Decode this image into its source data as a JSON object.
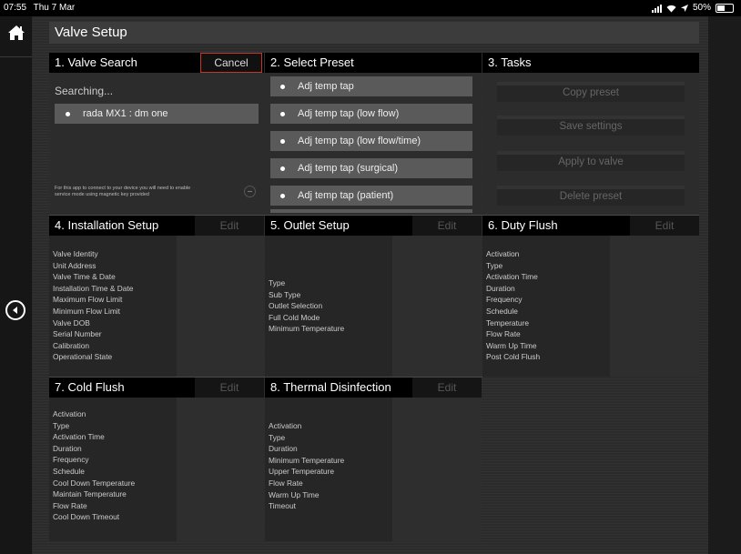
{
  "status_bar": {
    "time": "07:55",
    "date": "Thu 7 Mar",
    "battery": "50%",
    "battery_level": 0.5
  },
  "header": {
    "title": "Valve Setup"
  },
  "panels": {
    "valve_search": {
      "title": "1. Valve Search",
      "cancel_label": "Cancel",
      "searching_text": "Searching...",
      "device": "rada MX1  : dm one",
      "note_line1": "For this app to connect to your device you will need to enable",
      "note_line2": "service mode using magnetic key provided"
    },
    "select_preset": {
      "title": "2. Select Preset",
      "items": [
        "Adj temp tap",
        "Adj temp tap (low flow)",
        "Adj temp tap (low flow/time)",
        "Adj temp tap (surgical)",
        "Adj temp tap (patient)"
      ]
    },
    "tasks": {
      "title": "3. Tasks",
      "buttons": [
        "Copy preset",
        "Save settings",
        "Apply to valve",
        "Delete preset"
      ]
    },
    "installation_setup": {
      "title": "4. Installation Setup",
      "edit_label": "Edit",
      "fields": [
        "Valve Identity",
        "Unit Address",
        "Valve Time & Date",
        "Installation Time & Date",
        "Maximum Flow Limit",
        "Minimum Flow Limit",
        "Valve DOB",
        "Serial Number",
        "Calibration",
        "Operational State"
      ]
    },
    "outlet_setup": {
      "title": "5. Outlet Setup",
      "edit_label": "Edit",
      "fields": [
        "Type",
        "Sub Type",
        "Outlet Selection",
        "Full Cold Mode",
        "Minimum Temperature"
      ]
    },
    "duty_flush": {
      "title": "6. Duty Flush",
      "edit_label": "Edit",
      "fields": [
        "Activation",
        "Type",
        "Activation Time",
        "Duration",
        "Frequency",
        "Schedule",
        "Temperature",
        "Flow Rate",
        "Warm Up Time",
        "Post Cold Flush"
      ]
    },
    "cold_flush": {
      "title": "7. Cold Flush",
      "edit_label": "Edit",
      "fields": [
        "Activation",
        "Type",
        "Activation Time",
        "Duration",
        "Frequency",
        "Schedule",
        "Cool Down Temperature",
        "Maintain Temperature",
        "Flow Rate",
        "Cool Down Timeout"
      ]
    },
    "thermal_disinfection": {
      "title": "8. Thermal Disinfection",
      "edit_label": "Edit",
      "fields": [
        "Activation",
        "Type",
        "Duration",
        "Minimum Temperature",
        "Upper Temperature",
        "Flow Rate",
        "Warm Up Time",
        "Timeout"
      ]
    }
  },
  "icons": {
    "home": "home-icon",
    "back": "back-arrow-icon",
    "wifi": "wifi-icon",
    "location": "location-arrow-icon",
    "signal": "signal-icon",
    "battery": "battery-icon"
  }
}
